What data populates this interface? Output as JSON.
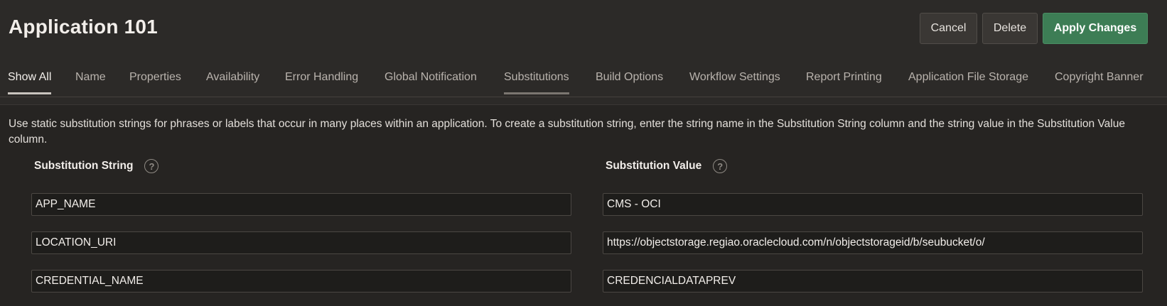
{
  "header": {
    "title": "Application 101",
    "cancel_label": "Cancel",
    "delete_label": "Delete",
    "apply_label": "Apply Changes"
  },
  "tabs": [
    {
      "label": "Show All"
    },
    {
      "label": "Name"
    },
    {
      "label": "Properties"
    },
    {
      "label": "Availability"
    },
    {
      "label": "Error Handling"
    },
    {
      "label": "Global Notification"
    },
    {
      "label": "Substitutions"
    },
    {
      "label": "Build Options"
    },
    {
      "label": "Workflow Settings"
    },
    {
      "label": "Report Printing"
    },
    {
      "label": "Application File Storage"
    },
    {
      "label": "Copyright Banner"
    }
  ],
  "section": {
    "description": "Use static substitution strings for phrases or labels that occur in many places within an application. To create a substitution string, enter the string name in the Substitution String column and the string value in the Substitution Value column.",
    "col_string": "Substitution String",
    "col_value": "Substitution Value",
    "help_glyph": "?"
  },
  "rows": [
    {
      "string": "APP_NAME",
      "value": "CMS - OCI"
    },
    {
      "string": "LOCATION_URI",
      "value": "https://objectstorage.regiao.oraclecloud.com/n/objectstorageid/b/seubucket/o/"
    },
    {
      "string": "CREDENTIAL_NAME",
      "value": "CREDENCIALDATAPREV"
    }
  ],
  "colors": {
    "background": "#2c2a28",
    "apply_button": "#3d7d55"
  }
}
